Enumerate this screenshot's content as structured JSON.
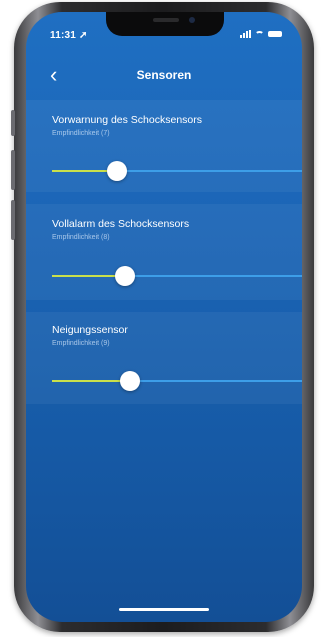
{
  "status_bar": {
    "time": "11:31 ➚"
  },
  "nav": {
    "back_icon": "chevron-left-icon",
    "title": "Sensoren"
  },
  "sensors": [
    {
      "title": "Vorwarnung des Schocksensors",
      "subtitle": "Empfindlichkeit (7)",
      "value_fraction": 0.26
    },
    {
      "title": "Vollalarm des Schocksensors",
      "subtitle": "Empfindlichkeit (8)",
      "value_fraction": 0.29
    },
    {
      "title": "Neigungssensor",
      "subtitle": "Empfindlichkeit (9)",
      "value_fraction": 0.31
    }
  ],
  "colors": {
    "background": "#1b65b6",
    "slider_fill": "#c9e04b",
    "slider_track": "#3d9ee8",
    "thumb": "#ffffff"
  }
}
